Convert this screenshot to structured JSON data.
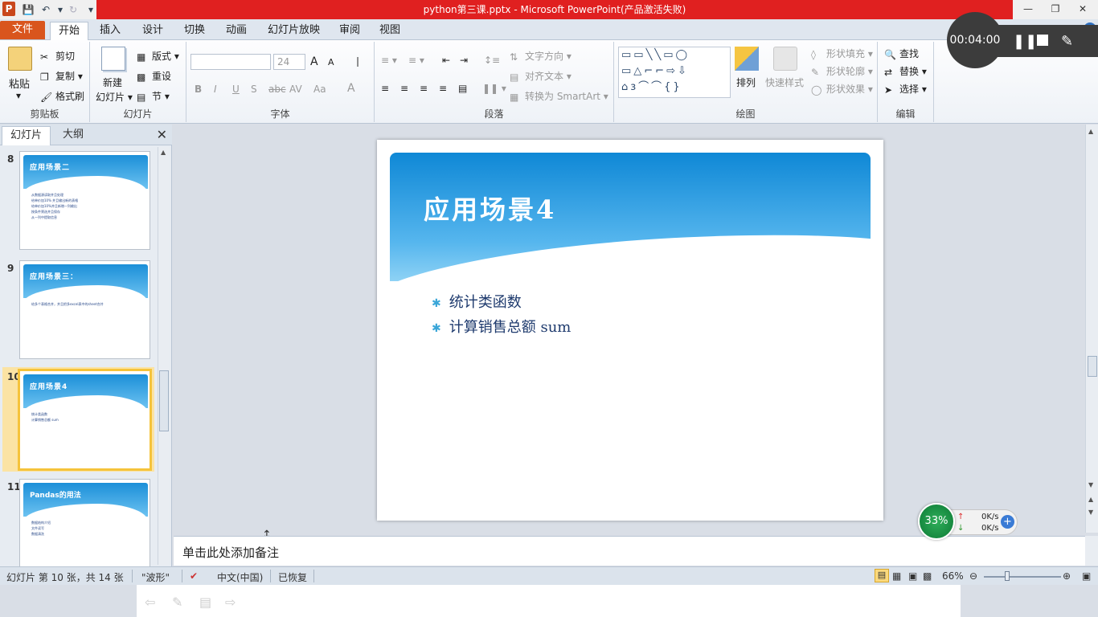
{
  "window": {
    "title": "python第三课.pptx - Microsoft PowerPoint(产品激活失败)",
    "logo": "P"
  },
  "ribbon_tabs": [
    "文件",
    "开始",
    "插入",
    "设计",
    "切换",
    "动画",
    "幻灯片放映",
    "审阅",
    "视图"
  ],
  "clipboard": {
    "paste": "粘贴",
    "cut": "剪切",
    "copy": "复制",
    "format_painter": "格式刷",
    "label": "剪贴板"
  },
  "slides_group": {
    "new_slide_line1": "新建",
    "new_slide_line2": "幻灯片",
    "layout": "版式",
    "reset": "重设",
    "section": "节",
    "label": "幻灯片"
  },
  "font_group": {
    "font_name": "",
    "font_size": "24",
    "bold": "B",
    "italic": "I",
    "underline": "U",
    "shadow": "S",
    "strike": "abc",
    "spacing": "AV",
    "case": "Aa",
    "color": "A",
    "grow": "A",
    "shrink": "A",
    "label": "字体"
  },
  "paragraph_group": {
    "text_direction": "文字方向",
    "align_text": "对齐文本",
    "smartart": "转换为 SmartArt",
    "label": "段落"
  },
  "drawing_group": {
    "arrange": "排列",
    "quick_styles": "快速样式",
    "shape_fill": "形状填充",
    "shape_outline": "形状轮廓",
    "shape_effects": "形状效果",
    "label": "绘图"
  },
  "editing_group": {
    "find": "查找",
    "replace": "替换",
    "select": "选择",
    "label": "编辑"
  },
  "left_pane": {
    "tab_slides": "幻灯片",
    "tab_outline": "大纲",
    "thumbnails": [
      {
        "number": "8",
        "title": "应用场景二",
        "lines": [
          "从数据源读取并且处理",
          "给单价加10% 并且输出新的表格",
          "给单价加10%并且新增一列输出",
          "按条件筛选并且保存",
          "从一列中提取信息"
        ]
      },
      {
        "number": "9",
        "title": "应用场景三：",
        "lines": [
          "给多个表格合并，并且把多excel表中的sheet合并"
        ]
      },
      {
        "number": "10",
        "title": "应用场景4",
        "lines": [
          "统计类函数",
          "计算销售总额 sum"
        ]
      },
      {
        "number": "11",
        "title": "Pandas的用法",
        "lines": [
          "数据结构介绍",
          "文件读写",
          "数据清洗"
        ]
      }
    ]
  },
  "slide": {
    "title": "应用场景4",
    "bullets": [
      "统计类函数",
      "计算销售总额 sum"
    ]
  },
  "notes": {
    "placeholder": "单击此处添加备注"
  },
  "statusbar": {
    "slide_info": "幻灯片 第 10 张，共 14 张",
    "theme": "\"波形\"",
    "language": "中文(中国)",
    "status": "已恢复",
    "zoom": "66%"
  },
  "recorder": {
    "time": "00:04:00"
  },
  "speed_widget": {
    "percent": "33%",
    "upload": "0K/s",
    "download": "0K/s"
  },
  "colors": {
    "title_bar_red": "#e02020",
    "file_tab": "#d9551d",
    "selection": "#f5c33b",
    "slide_band": "#1b8fd8"
  }
}
